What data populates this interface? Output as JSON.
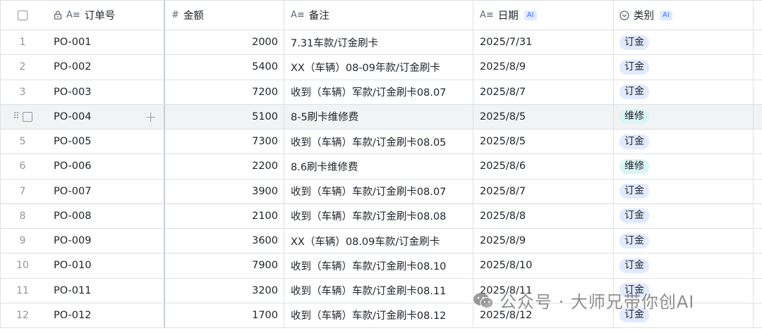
{
  "columns": {
    "order": "订单号",
    "amount": "金额",
    "note": "备注",
    "date": "日期",
    "category": "类别",
    "ai_badge": "AI"
  },
  "icons": {
    "lock": "lock-icon",
    "text_field": "A≡",
    "number_field": "#",
    "single_select": "chevron-circle-icon",
    "drag": "⠿",
    "add": "+"
  },
  "tag_colors": {
    "订金": "#e1eaff",
    "维修": "#d9f5f6"
  },
  "rows": [
    {
      "index": "1",
      "order": "PO-001",
      "amount": "2000",
      "note": "7.31车款/订金刷卡",
      "date": "2025/7/31",
      "category": "订金"
    },
    {
      "index": "2",
      "order": "PO-002",
      "amount": "5400",
      "note": "XX（车辆）08-09年款/订金刷卡",
      "date": "2025/8/9",
      "category": "订金"
    },
    {
      "index": "3",
      "order": "PO-003",
      "amount": "7200",
      "note": "收到（车辆）军款/订金刷卡08.07",
      "date": "2025/8/7",
      "category": "订金"
    },
    {
      "index": "4",
      "order": "PO-004",
      "amount": "5100",
      "note": "8-5刷卡维修费",
      "date": "2025/8/5",
      "category": "维修"
    },
    {
      "index": "5",
      "order": "PO-005",
      "amount": "7300",
      "note": "收到（车辆）车款/订金刷卡08.05",
      "date": "2025/8/5",
      "category": "订金"
    },
    {
      "index": "6",
      "order": "PO-006",
      "amount": "2200",
      "note": "8.6刷卡维修费",
      "date": "2025/8/6",
      "category": "维修"
    },
    {
      "index": "7",
      "order": "PO-007",
      "amount": "3900",
      "note": "收到（车辆）车款/订金刷卡08.07",
      "date": "2025/8/7",
      "category": "订金"
    },
    {
      "index": "8",
      "order": "PO-008",
      "amount": "2100",
      "note": "收到（车辆）车款/订金刷卡08.08",
      "date": "2025/8/8",
      "category": "订金"
    },
    {
      "index": "9",
      "order": "PO-009",
      "amount": "3600",
      "note": "XX（车辆）08.09车款/订金刷卡",
      "date": "2025/8/9",
      "category": "订金"
    },
    {
      "index": "10",
      "order": "PO-010",
      "amount": "7900",
      "note": "收到（车辆）车款/订金刷卡08.10",
      "date": "2025/8/10",
      "category": "订金"
    },
    {
      "index": "11",
      "order": "PO-011",
      "amount": "3200",
      "note": "收到（车辆）车款/订金刷卡08.11",
      "date": "2025/8/11",
      "category": "订金"
    },
    {
      "index": "12",
      "order": "PO-012",
      "amount": "1700",
      "note": "收到（车辆）车款/订金刷卡08.12",
      "date": "2025/8/12",
      "category": "订金"
    }
  ],
  "hover_row": 3,
  "watermark": "公众号 · 大师兄带你创AI"
}
